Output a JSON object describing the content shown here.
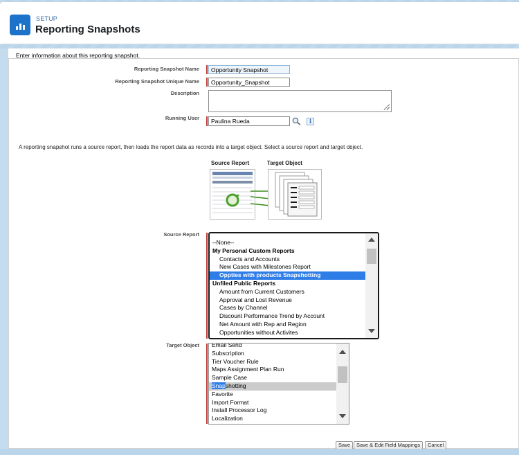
{
  "header": {
    "section": "SETUP",
    "title": "Reporting Snapshots"
  },
  "intro": "Enter information about this reporting snapshot.",
  "form": {
    "name": {
      "label": "Reporting Snapshot Name",
      "value": "Opportunity Snapshot"
    },
    "unique_name": {
      "label": "Reporting Snapshot Unique Name",
      "value": "Opportunity_Snapshot"
    },
    "description": {
      "label": "Description",
      "value": ""
    },
    "running_user": {
      "label": "Running User",
      "value": "Paulina Rueda"
    }
  },
  "info_icon_glyph": "i",
  "explanation": "A reporting snapshot runs a source report, then loads the report data as records into a target object. Select a source report and target object.",
  "figure": {
    "source_label": "Source Report",
    "target_label": "Target Object"
  },
  "source_report": {
    "label": "Source Report",
    "options": [
      {
        "text": "--None--",
        "kind": "plain"
      },
      {
        "text": "My Personal Custom Reports",
        "kind": "group"
      },
      {
        "text": "Contacts and Accounts",
        "kind": "item"
      },
      {
        "text": "New Cases with Milestones Report",
        "kind": "item"
      },
      {
        "text": "Oppties with products Snapshotting",
        "kind": "selected"
      },
      {
        "text": "Unfiled Public Reports",
        "kind": "group"
      },
      {
        "text": "Amount from Current Customers",
        "kind": "item"
      },
      {
        "text": "Approval and Lost Revenue",
        "kind": "item"
      },
      {
        "text": "Cases by Channel",
        "kind": "item"
      },
      {
        "text": "Discount Performance Trend by Account",
        "kind": "item"
      },
      {
        "text": "Net Amount with Rep and Region",
        "kind": "item"
      },
      {
        "text": "Opportunities without Activites",
        "kind": "item"
      }
    ]
  },
  "target_object": {
    "label": "Target Object",
    "options": [
      {
        "text": "Email Send",
        "kind": "plain"
      },
      {
        "text": "Subscription",
        "kind": "plain"
      },
      {
        "text": "Tier Voucher Rule",
        "kind": "plain"
      },
      {
        "text": "Maps Assignment Plan Run",
        "kind": "plain"
      },
      {
        "text": "Sample Case",
        "kind": "plain"
      },
      {
        "text": "Snapshotting",
        "kind": "selected",
        "highlight_prefix": "Snap",
        "rest": "shotting"
      },
      {
        "text": "Favorite",
        "kind": "plain"
      },
      {
        "text": "Import Format",
        "kind": "plain"
      },
      {
        "text": "Install Processor Log",
        "kind": "plain"
      },
      {
        "text": "Localization",
        "kind": "plain"
      }
    ]
  },
  "buttons": {
    "save": "Save",
    "save_edit": "Save & Edit Field Mappings",
    "cancel": "Cancel"
  },
  "colors": {
    "brand": "#1d73c9",
    "required": "#c23934",
    "selection": "#2f7ee8"
  }
}
